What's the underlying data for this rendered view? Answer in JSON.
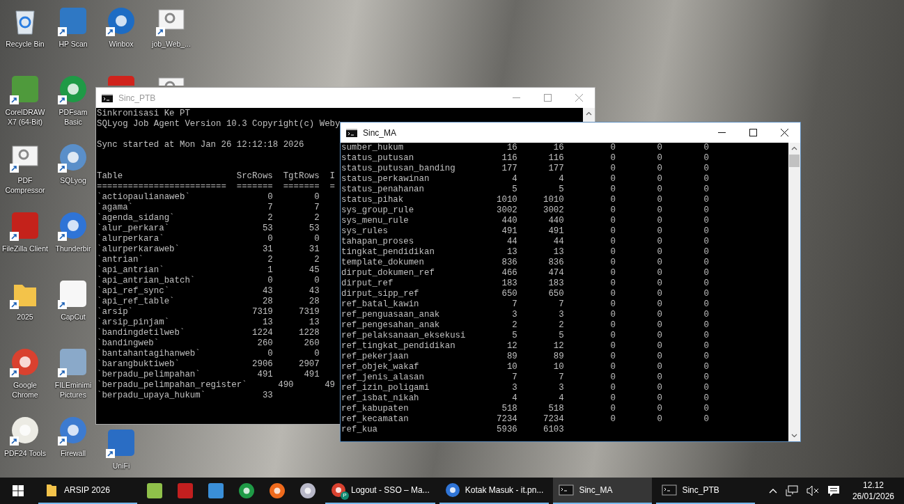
{
  "desktop": {
    "columns": [
      [
        {
          "label": "Recycle Bin"
        },
        {
          "label": "CorelDRAW X7 (64-Bit)"
        },
        {
          "label": "PDF Compressor"
        },
        {
          "label": "FileZilla Client"
        },
        {
          "label": "2025"
        },
        {
          "label": "Google Chrome"
        },
        {
          "label": "PDF24 Tools"
        }
      ],
      [
        {
          "label": "HP Scan"
        },
        {
          "label": "PDFsam Basic"
        },
        {
          "label": "SQLyog"
        },
        {
          "label": "Thunderbir"
        },
        {
          "label": "CapCut"
        },
        {
          "label": "FILEminimi Pictures"
        },
        {
          "label": "Firewall"
        }
      ],
      [
        {
          "label": "Winbox"
        },
        {},
        {
          "label": "UniFi"
        }
      ],
      [
        {
          "label": "job_Web_..."
        },
        {}
      ]
    ]
  },
  "windows": [
    {
      "title": "Sinc_PTB",
      "active": false,
      "intro": [
        "Sinkronisasi Ke PT",
        "SQLyog Job Agent Version 10.3 Copyright(c) Weby"
      ],
      "sync_line": "Sync started at Mon Jan 26 12:12:18 2026",
      "table": {
        "columns": [
          "Table",
          "SrcRows",
          "TgtRows",
          "I"
        ],
        "rule": [
          "=========================",
          "=======",
          "=======",
          "="
        ],
        "rows": [
          {
            "kind": "row",
            "cells": [
              "`actiopaulianaweb`",
              "0",
              "0"
            ]
          },
          {
            "kind": "row",
            "cells": [
              "`agama`",
              "7",
              "7"
            ]
          },
          {
            "kind": "row",
            "cells": [
              "`agenda_sidang`",
              "2",
              "2"
            ]
          },
          {
            "kind": "row",
            "cells": [
              "`alur_perkara`",
              "53",
              "53"
            ]
          },
          {
            "kind": "row",
            "cells": [
              "`alurperkara`",
              "0",
              "0"
            ]
          },
          {
            "kind": "row",
            "cells": [
              "`alurperkaraweb`",
              "31",
              "31"
            ]
          },
          {
            "kind": "row",
            "cells": [
              "`antrian`",
              "2",
              "2"
            ]
          },
          {
            "kind": "row",
            "cells": [
              "`api_antrian`",
              "1",
              "45"
            ]
          },
          {
            "kind": "row",
            "cells": [
              "`api_antrian_batch`",
              "0",
              "0"
            ]
          },
          {
            "kind": "row",
            "cells": [
              "`api_ref_sync`",
              "43",
              "43"
            ]
          },
          {
            "kind": "row",
            "cells": [
              "`api_ref_table`",
              "28",
              "28"
            ]
          },
          {
            "kind": "row",
            "cells": [
              "`arsip`",
              "7319",
              "7319"
            ]
          },
          {
            "kind": "row",
            "cells": [
              "`arsip_pinjam`",
              "13",
              "13"
            ]
          },
          {
            "kind": "row",
            "cells": [
              "`bandingdetilweb`",
              "1224",
              "1228"
            ]
          },
          {
            "kind": "row",
            "cells": [
              "`bandingweb`",
              "260",
              "260"
            ]
          },
          {
            "kind": "row",
            "cells": [
              "`bantahantagihanweb`",
              "0",
              "0"
            ]
          },
          {
            "kind": "row",
            "cells": [
              "`barangbuktiweb`",
              "2906",
              "2907"
            ]
          },
          {
            "kind": "row",
            "cells": [
              "`berpadu_pelimpahan`",
              "491",
              "491"
            ]
          },
          {
            "kind": "line",
            "text": "`berpadu_pelimpahan_register`      490      49"
          },
          {
            "kind": "row",
            "cells": [
              "`berpadu_upaya_hukum`",
              "33"
            ]
          }
        ]
      }
    },
    {
      "title": "Sinc_MA",
      "active": true,
      "table": {
        "rows": [
          {
            "kind": "row",
            "cells": [
              "sumber_hukum",
              "16",
              "16",
              "0",
              "0",
              "0"
            ]
          },
          {
            "kind": "row",
            "cells": [
              "status_putusan",
              "116",
              "116",
              "0",
              "0",
              "0"
            ]
          },
          {
            "kind": "row",
            "cells": [
              "status_putusan_banding",
              "177",
              "177",
              "0",
              "0",
              "0"
            ]
          },
          {
            "kind": "row",
            "cells": [
              "status_perkawinan",
              "4",
              "4",
              "0",
              "0",
              "0"
            ]
          },
          {
            "kind": "row",
            "cells": [
              "status_penahanan",
              "5",
              "5",
              "0",
              "0",
              "0"
            ]
          },
          {
            "kind": "row",
            "cells": [
              "status_pihak",
              "1010",
              "1010",
              "0",
              "0",
              "0"
            ]
          },
          {
            "kind": "row",
            "cells": [
              "sys_group_rule",
              "3002",
              "3002",
              "0",
              "0",
              "0"
            ]
          },
          {
            "kind": "row",
            "cells": [
              "sys_menu_rule",
              "440",
              "440",
              "0",
              "0",
              "0"
            ]
          },
          {
            "kind": "row",
            "cells": [
              "sys_rules",
              "491",
              "491",
              "0",
              "0",
              "0"
            ]
          },
          {
            "kind": "row",
            "cells": [
              "tahapan_proses",
              "44",
              "44",
              "0",
              "0",
              "0"
            ]
          },
          {
            "kind": "row",
            "cells": [
              "tingkat_pendidikan",
              "13",
              "13",
              "0",
              "0",
              "0"
            ]
          },
          {
            "kind": "row",
            "cells": [
              "template_dokumen",
              "836",
              "836",
              "0",
              "0",
              "0"
            ]
          },
          {
            "kind": "row",
            "cells": [
              "dirput_dokumen_ref",
              "466",
              "474",
              "0",
              "0",
              "0"
            ]
          },
          {
            "kind": "row",
            "cells": [
              "dirput_ref",
              "183",
              "183",
              "0",
              "0",
              "0"
            ]
          },
          {
            "kind": "row",
            "cells": [
              "dirput_sipp_ref",
              "650",
              "650",
              "0",
              "0",
              "0"
            ]
          },
          {
            "kind": "row",
            "cells": [
              "ref_batal_kawin",
              "7",
              "7",
              "0",
              "0",
              "0"
            ]
          },
          {
            "kind": "row",
            "cells": [
              "ref_penguasaan_anak",
              "3",
              "3",
              "0",
              "0",
              "0"
            ]
          },
          {
            "kind": "row",
            "cells": [
              "ref_pengesahan_anak",
              "2",
              "2",
              "0",
              "0",
              "0"
            ]
          },
          {
            "kind": "row",
            "cells": [
              "ref_pelaksanaan_eksekusi",
              "5",
              "5",
              "0",
              "0",
              "0"
            ]
          },
          {
            "kind": "row",
            "cells": [
              "ref_tingkat_pendidikan",
              "12",
              "12",
              "0",
              "0",
              "0"
            ]
          },
          {
            "kind": "row",
            "cells": [
              "ref_pekerjaan",
              "89",
              "89",
              "0",
              "0",
              "0"
            ]
          },
          {
            "kind": "row",
            "cells": [
              "ref_objek_wakaf",
              "10",
              "10",
              "0",
              "0",
              "0"
            ]
          },
          {
            "kind": "row",
            "cells": [
              "ref_jenis_alasan",
              "7",
              "7",
              "0",
              "0",
              "0"
            ]
          },
          {
            "kind": "row",
            "cells": [
              "ref_izin_poligami",
              "3",
              "3",
              "0",
              "0",
              "0"
            ]
          },
          {
            "kind": "row",
            "cells": [
              "ref_isbat_nikah",
              "4",
              "4",
              "0",
              "0",
              "0"
            ]
          },
          {
            "kind": "row",
            "cells": [
              "ref_kabupaten",
              "518",
              "518",
              "0",
              "0",
              "0"
            ]
          },
          {
            "kind": "row",
            "cells": [
              "ref_kecamatan",
              "7234",
              "7234",
              "0",
              "0",
              "0"
            ]
          },
          {
            "kind": "row",
            "cells": [
              "ref_kua",
              "5936",
              "6103"
            ]
          }
        ]
      }
    }
  ],
  "taskbar": {
    "buttons": [
      {
        "label": "ARSIP 2026",
        "selected": false
      },
      {
        "label": "Logout - SSO – Ma...",
        "badge": "P",
        "selected": false
      },
      {
        "label": "Kotak Masuk - it.pn...",
        "selected": false
      },
      {
        "label": "Sinc_MA",
        "selected": true
      },
      {
        "label": "Sinc_PTB",
        "selected": false
      }
    ],
    "time": "12.12",
    "date": "26/01/2026"
  }
}
